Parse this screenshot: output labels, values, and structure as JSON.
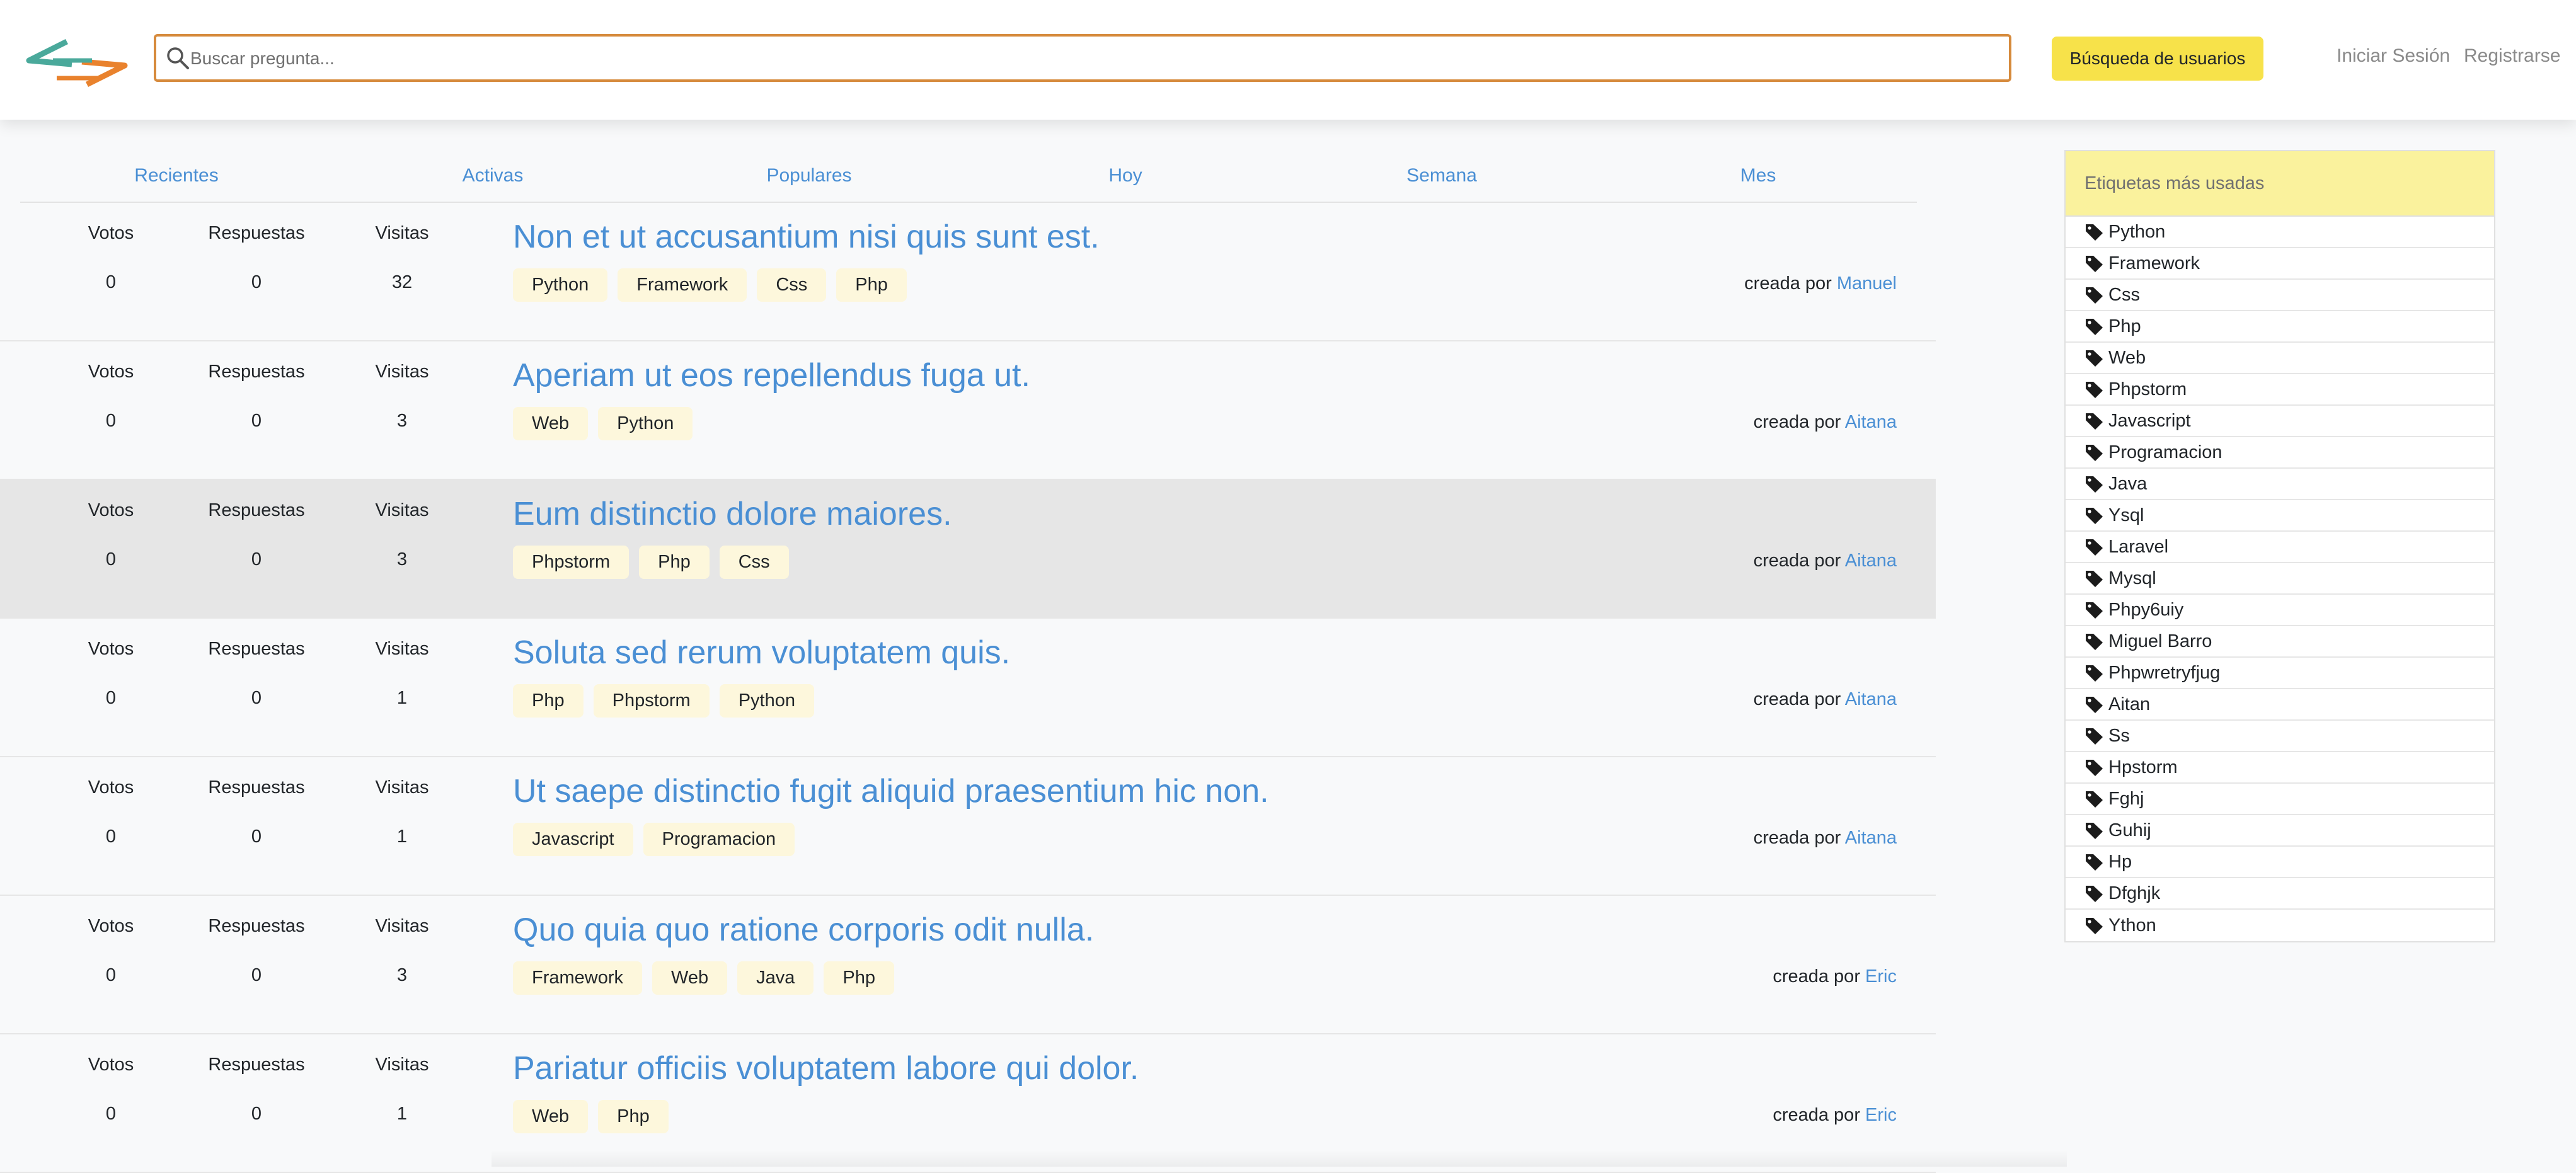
{
  "header": {
    "search_placeholder": "Buscar pregunta...",
    "users_button": "Búsqueda de usuarios",
    "login": "Iniciar Sesión",
    "register": "Registrarse",
    "logo_colors": [
      "#4aa99b",
      "#e9822d"
    ],
    "accent_color": "#f7e24a"
  },
  "filters": [
    "Recientes",
    "Activas",
    "Populares",
    "Hoy",
    "Semana",
    "Mes"
  ],
  "stat_labels": {
    "votes": "Votos",
    "answers": "Respuestas",
    "visits": "Visitas"
  },
  "created_by_prefix": "creada por",
  "questions": [
    {
      "title": "Non et ut accusantium nisi quis sunt est.",
      "votes": "0",
      "answers": "0",
      "visits": "32",
      "tags": [
        "Python",
        "Framework",
        "Css",
        "Php"
      ],
      "author": "Manuel",
      "highlighted": false
    },
    {
      "title": "Aperiam ut eos repellendus fuga ut.",
      "votes": "0",
      "answers": "0",
      "visits": "3",
      "tags": [
        "Web",
        "Python"
      ],
      "author": "Aitana",
      "highlighted": false
    },
    {
      "title": "Eum distinctio dolore maiores.",
      "votes": "0",
      "answers": "0",
      "visits": "3",
      "tags": [
        "Phpstorm",
        "Php",
        "Css"
      ],
      "author": "Aitana",
      "highlighted": true
    },
    {
      "title": "Soluta sed rerum voluptatem quis.",
      "votes": "0",
      "answers": "0",
      "visits": "1",
      "tags": [
        "Php",
        "Phpstorm",
        "Python"
      ],
      "author": "Aitana",
      "highlighted": false
    },
    {
      "title": "Ut saepe distinctio fugit aliquid praesentium hic non.",
      "votes": "0",
      "answers": "0",
      "visits": "1",
      "tags": [
        "Javascript",
        "Programacion"
      ],
      "author": "Aitana",
      "highlighted": false
    },
    {
      "title": "Quo quia quo ratione corporis odit nulla.",
      "votes": "0",
      "answers": "0",
      "visits": "3",
      "tags": [
        "Framework",
        "Web",
        "Java",
        "Php"
      ],
      "author": "Eric",
      "highlighted": false
    },
    {
      "title": "Pariatur officiis voluptatem labore qui dolor.",
      "votes": "0",
      "answers": "0",
      "visits": "1",
      "tags": [
        "Web",
        "Php"
      ],
      "author": "Eric",
      "highlighted": false
    }
  ],
  "sidebar": {
    "title": "Etiquetas más usadas",
    "tags": [
      "Python",
      "Framework",
      "Css",
      "Php",
      "Web",
      "Phpstorm",
      "Javascript",
      "Programacion",
      "Java",
      "Ysql",
      "Laravel",
      "Mysql",
      "Phpy6uiy",
      "Miguel Barro",
      "Phpwretryfjug",
      "Aitan",
      "Ss",
      "Hpstorm",
      "Fghj",
      "Guhij",
      "Hp",
      "Dfghjk",
      "Ython"
    ],
    "tag_icon": "tag-icon"
  }
}
